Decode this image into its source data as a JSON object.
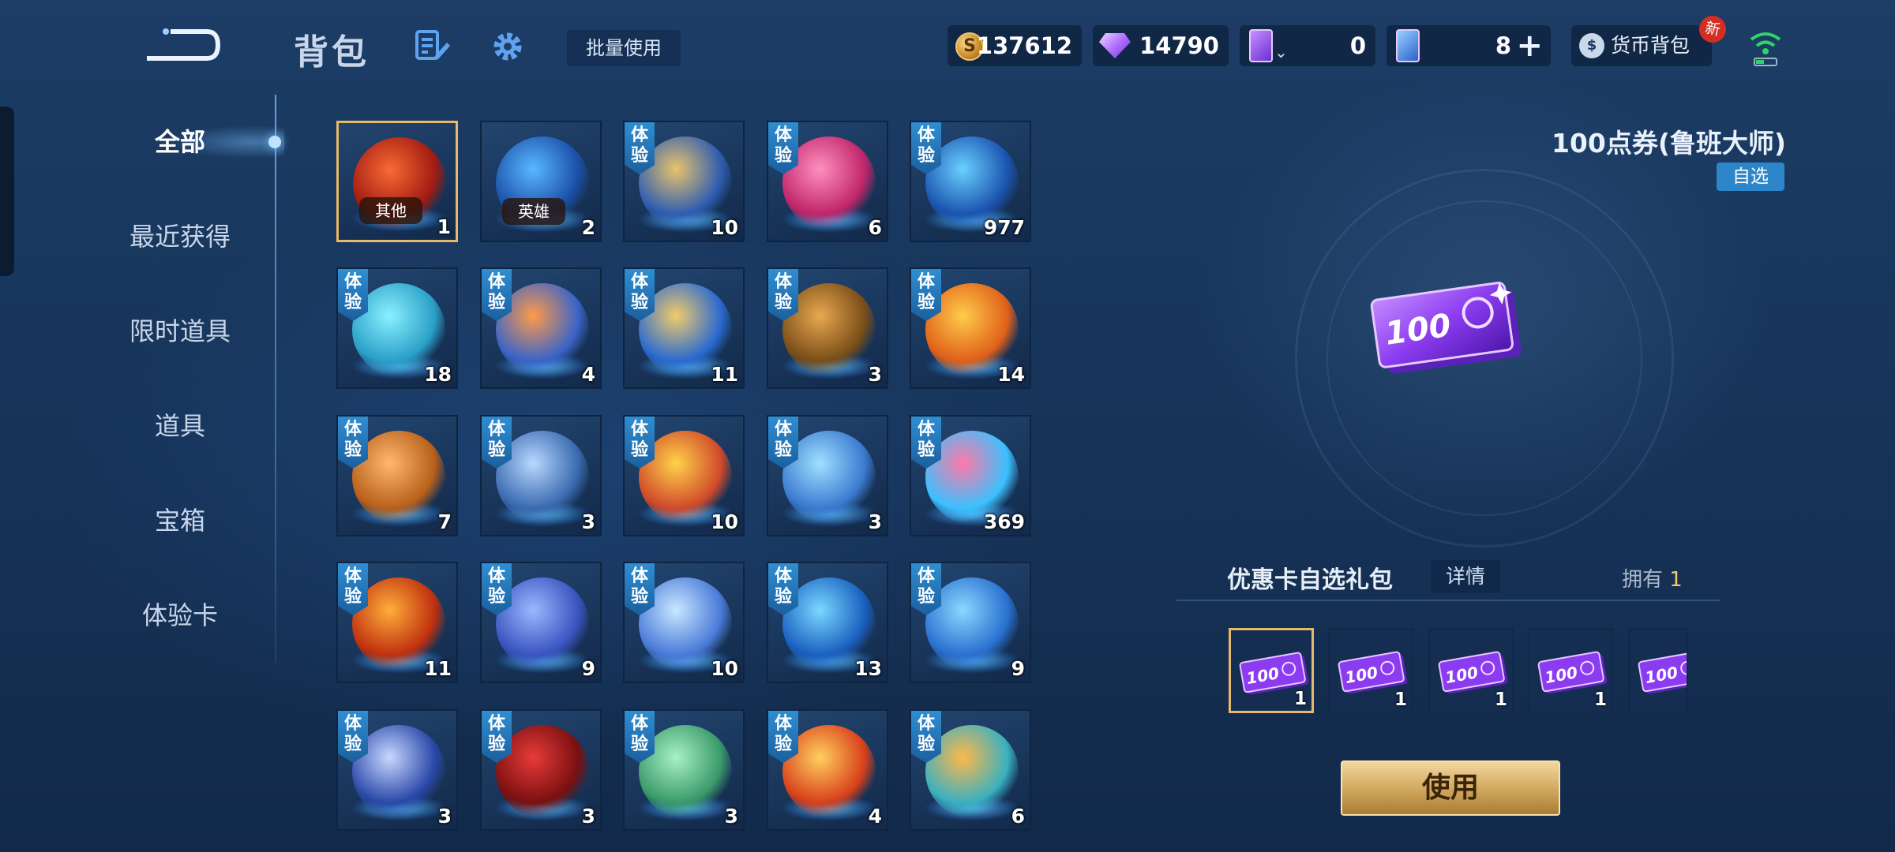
{
  "header": {
    "title": "背包",
    "batch_use": "批量使用",
    "new_badge": "新",
    "wallet_label": "货币背包"
  },
  "currencies": [
    {
      "name": "coin",
      "value": "137612"
    },
    {
      "name": "diamond",
      "value": "14790"
    },
    {
      "name": "card-a",
      "value": "0"
    },
    {
      "name": "card-b",
      "value": "8"
    }
  ],
  "sidebar": {
    "items": [
      {
        "label": "全部",
        "active": true
      },
      {
        "label": "最近获得"
      },
      {
        "label": "限时道具"
      },
      {
        "label": "道具"
      },
      {
        "label": "宝箱"
      },
      {
        "label": "体验卡"
      }
    ]
  },
  "trial_tag": "体验",
  "grid": [
    {
      "count": "1",
      "label": "其他",
      "colors": [
        "#f86a33",
        "#a11b12"
      ]
    },
    {
      "count": "2",
      "label": "英雄",
      "colors": [
        "#5ab8ff",
        "#1b4fa8"
      ]
    },
    {
      "count": "10",
      "colors": [
        "#e8c46c",
        "#2f5db0"
      ]
    },
    {
      "count": "6",
      "colors": [
        "#ff8fc0",
        "#c0266a"
      ]
    },
    {
      "count": "977",
      "colors": [
        "#6ad0ff",
        "#1b54b0"
      ]
    },
    {
      "count": "18",
      "colors": [
        "#8af0ff",
        "#2aa0c8"
      ]
    },
    {
      "count": "4",
      "colors": [
        "#ff9a4a",
        "#3a64c8"
      ]
    },
    {
      "count": "11",
      "colors": [
        "#f2cb6a",
        "#2a6ad0"
      ]
    },
    {
      "count": "3",
      "colors": [
        "#e8a850",
        "#7a4e18"
      ]
    },
    {
      "count": "14",
      "colors": [
        "#ffcc4a",
        "#e0601a"
      ]
    },
    {
      "count": "7",
      "colors": [
        "#ffb870",
        "#b8601a"
      ]
    },
    {
      "count": "3",
      "colors": [
        "#b8d8ff",
        "#3a6ab0"
      ]
    },
    {
      "count": "10",
      "colors": [
        "#ffd24a",
        "#d04a2a"
      ]
    },
    {
      "count": "3",
      "colors": [
        "#a0e0ff",
        "#3a7ad0"
      ]
    },
    {
      "count": "369",
      "colors": [
        "#ff7aa8",
        "#3ac0ff"
      ]
    },
    {
      "count": "11",
      "colors": [
        "#ffae3a",
        "#c0300f"
      ]
    },
    {
      "count": "9",
      "colors": [
        "#9ab8ff",
        "#3a54c0"
      ]
    },
    {
      "count": "10",
      "colors": [
        "#c8e8ff",
        "#4a7ad8"
      ]
    },
    {
      "count": "13",
      "colors": [
        "#7ad8ff",
        "#1a60c0"
      ]
    },
    {
      "count": "9",
      "colors": [
        "#8ad8ff",
        "#2a70d0"
      ]
    },
    {
      "count": "3",
      "colors": [
        "#c8d8ff",
        "#2a48a8"
      ]
    },
    {
      "count": "3",
      "colors": [
        "#e83a3a",
        "#7a1010"
      ]
    },
    {
      "count": "3",
      "colors": [
        "#a8f0c8",
        "#3a9a6a"
      ]
    },
    {
      "count": "4",
      "colors": [
        "#ffd060",
        "#d8401a"
      ]
    },
    {
      "count": "6",
      "colors": [
        "#ffb84a",
        "#3ab0c0"
      ]
    }
  ],
  "detail": {
    "item_name": "100点券(鲁班大师)",
    "free_tag": "自选",
    "ticket_text": "100",
    "pack_title": "优惠卡自选礼包",
    "detail_button": "详情",
    "own_label": "拥有",
    "own_count": "1",
    "options": [
      {
        "count": "1",
        "ticket_text": "100"
      },
      {
        "count": "1",
        "ticket_text": "100"
      },
      {
        "count": "1",
        "ticket_text": "100"
      },
      {
        "count": "1",
        "ticket_text": "100"
      },
      {
        "count": "",
        "ticket_text": "100"
      }
    ],
    "use_button": "使用"
  },
  "colors": {
    "accent": "#2f8ed2",
    "gold": "#e8b96a",
    "ticket": "#8b3cf0"
  }
}
